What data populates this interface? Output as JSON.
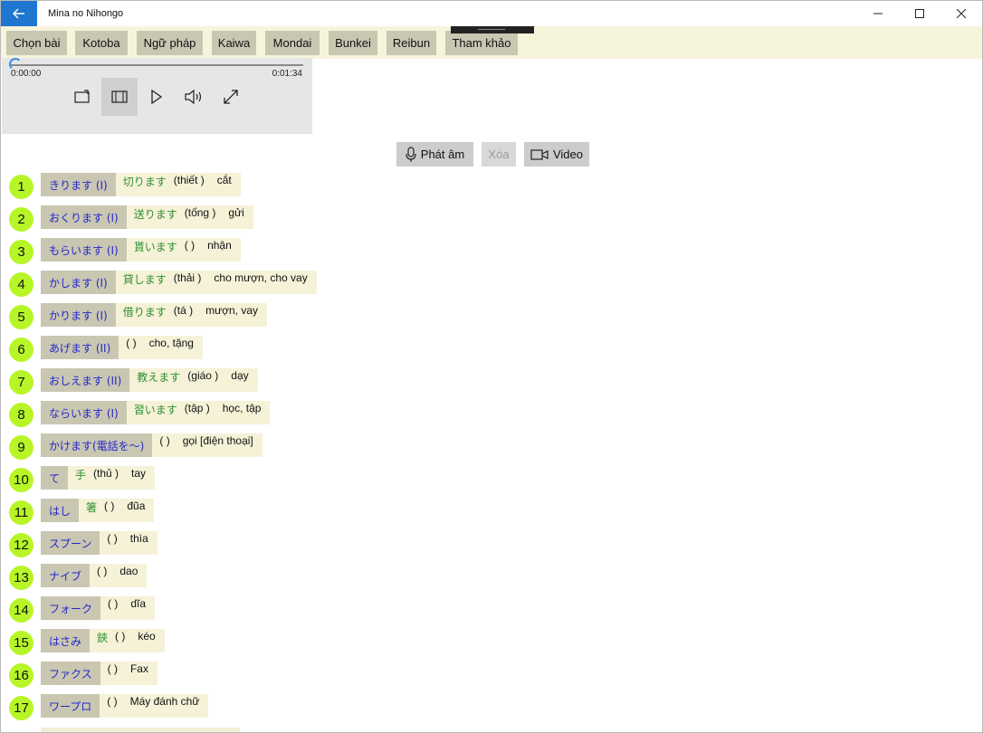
{
  "window": {
    "title": "Mina no Nihongo",
    "controls": {
      "minimize": "—",
      "maximize": "☐",
      "close": "✕"
    },
    "back_icon": "arrow-left-icon"
  },
  "tabs": [
    {
      "label": "Chọn bài"
    },
    {
      "label": "Kotoba"
    },
    {
      "label": "Ngữ pháp"
    },
    {
      "label": "Kaiwa"
    },
    {
      "label": "Mondai"
    },
    {
      "label": "Bunkei"
    },
    {
      "label": "Reibun"
    },
    {
      "label": "Tham khảo"
    }
  ],
  "player": {
    "elapsed": "0:00:00",
    "total": "0:01:34",
    "progress": 0.0
  },
  "actions": {
    "record": "Phát âm",
    "delete": "Xóa",
    "video": "Video"
  },
  "colors": {
    "accent": "#1e76d0",
    "tab_bg": "#c9c6b2",
    "strip_bg": "#f7f4dc",
    "number_badge": "#b8f527",
    "kana_text": "#2329c9",
    "kanji_text": "#2f8f2f"
  },
  "vocab": [
    {
      "num": "1",
      "kana": "きります (I)",
      "kanji": "切ります",
      "hv": "(thiết )",
      "meaning": "cắt"
    },
    {
      "num": "2",
      "kana": "おくります (I)",
      "kanji": "送ります",
      "hv": "(tống )",
      "meaning": "gửi"
    },
    {
      "num": "3",
      "kana": "もらいます (I)",
      "kanji": "貰います",
      "hv": "( )",
      "meaning": "nhận"
    },
    {
      "num": "4",
      "kana": "かします (I)",
      "kanji": "貸します",
      "hv": "(thải )",
      "meaning": "cho mượn, cho vay"
    },
    {
      "num": "5",
      "kana": "かります (I)",
      "kanji": "借ります",
      "hv": "(tá )",
      "meaning": "mượn, vay"
    },
    {
      "num": "6",
      "kana": "あげます (II)",
      "kanji": "",
      "hv": "( )",
      "meaning": "cho, tặng"
    },
    {
      "num": "7",
      "kana": "おしえます (II)",
      "kanji": "教えます",
      "hv": "(giáo )",
      "meaning": "dạy"
    },
    {
      "num": "8",
      "kana": "ならいます (I)",
      "kanji": "習います",
      "hv": "(tập )",
      "meaning": "học, tập"
    },
    {
      "num": "9",
      "kana": "かけます(電話を～)",
      "kanji": "",
      "hv": "( )",
      "meaning": "gọi [điện thoại]"
    },
    {
      "num": "10",
      "kana": "て",
      "kanji": "手",
      "hv": "(thủ )",
      "meaning": "tay"
    },
    {
      "num": "11",
      "kana": "はし",
      "kanji": "箸",
      "hv": "( )",
      "meaning": "đũa"
    },
    {
      "num": "12",
      "kana": "スプーン",
      "kanji": "",
      "hv": "( )",
      "meaning": "thìa"
    },
    {
      "num": "13",
      "kana": "ナイブ",
      "kanji": "",
      "hv": "( )",
      "meaning": "dao"
    },
    {
      "num": "14",
      "kana": "フォーク",
      "kanji": "",
      "hv": "( )",
      "meaning": "dĩa"
    },
    {
      "num": "15",
      "kana": "はさみ",
      "kanji": "鋏",
      "hv": "( )",
      "meaning": "kéo"
    },
    {
      "num": "16",
      "kana": "ファクス",
      "kanji": "",
      "hv": "( )",
      "meaning": "Fax"
    },
    {
      "num": "17",
      "kana": "ワープロ",
      "kanji": "",
      "hv": "( )",
      "meaning": "Máy đánh chữ"
    }
  ]
}
